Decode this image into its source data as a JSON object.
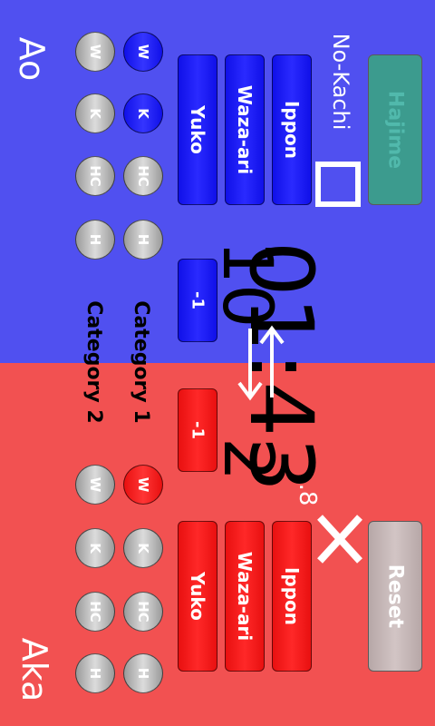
{
  "sides": {
    "top": {
      "name": "Ao",
      "color": "#5050f0",
      "button_color": "#1e1eff"
    },
    "bottom": {
      "name": "Aka",
      "color": "#f25151",
      "button_color": "#ff2020"
    }
  },
  "controls": {
    "hajime": "Hajime",
    "reset": "Reset",
    "no_kachi": "No-Kachi"
  },
  "scores": {
    "ippon": "Ippon",
    "waza_ari": "Waza-ari",
    "yuko": "Yuko",
    "minus_one": "-1"
  },
  "penalties": {
    "w": "W",
    "k": "K",
    "hc": "HC",
    "h": "H"
  },
  "categories": {
    "one": "Category 1",
    "two": "Category 2"
  },
  "timer": {
    "time": "01:43",
    "tenths": ".8"
  },
  "score": {
    "ao": "10",
    "aka": "2"
  }
}
